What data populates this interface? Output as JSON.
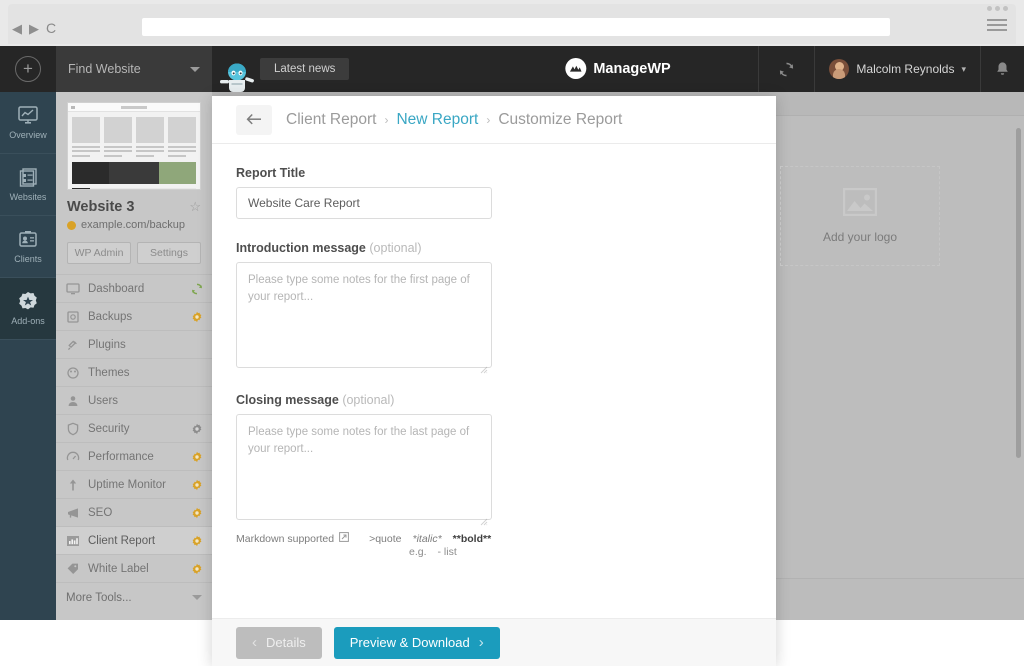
{
  "browser": {
    "back_icon": "back-arrow-icon",
    "forward_icon": "forward-arrow-icon",
    "reload_glyph": "C",
    "address_value": "",
    "address_placeholder": "",
    "menu_icon": "hamburger-menu-icon",
    "dots_icon": "more-options-icon"
  },
  "rail": {
    "add_label": "+",
    "items": [
      {
        "label": "Overview",
        "icon": "overview-monitor-icon"
      },
      {
        "label": "Websites",
        "icon": "websites-list-icon"
      },
      {
        "label": "Clients",
        "icon": "clients-card-icon"
      },
      {
        "label": "Add-ons",
        "icon": "addons-star-badge-icon"
      }
    ]
  },
  "sidebar": {
    "find_website": "Find Website",
    "site_name": "Website 3",
    "site_url": "example.com/backup",
    "favorite_icon": "star-icon",
    "status_dot_color": "#d9a227",
    "wp_admin_label": "WP Admin",
    "settings_label": "Settings",
    "more_tools_label": "More Tools...",
    "menu": [
      {
        "label": "Dashboard",
        "icon": "dashboard-monitor-icon",
        "badge": "sync",
        "active": false
      },
      {
        "label": "Backups",
        "icon": "backups-drive-icon",
        "badge": "gold",
        "active": false
      },
      {
        "label": "Plugins",
        "icon": "plugins-plug-icon",
        "badge": "none",
        "active": false
      },
      {
        "label": "Themes",
        "icon": "themes-brush-icon",
        "badge": "none",
        "active": false
      },
      {
        "label": "Users",
        "icon": "users-person-icon",
        "badge": "none",
        "active": false
      },
      {
        "label": "Security",
        "icon": "security-shield-icon",
        "badge": "gray",
        "active": false
      },
      {
        "label": "Performance",
        "icon": "performance-gauge-icon",
        "badge": "gold",
        "active": false
      },
      {
        "label": "Uptime Monitor",
        "icon": "uptime-arrow-icon",
        "badge": "gold",
        "active": false
      },
      {
        "label": "SEO",
        "icon": "seo-megaphone-icon",
        "badge": "gold",
        "active": false
      },
      {
        "label": "Client Report",
        "icon": "client-report-chart-icon",
        "badge": "gold",
        "active": true
      },
      {
        "label": "White Label",
        "icon": "white-label-tag-icon",
        "badge": "gold",
        "active": false
      }
    ]
  },
  "topbar": {
    "news_label": "Latest news",
    "brand_name": "ManageWP",
    "brand_mark_icon": "managewp-logo-icon",
    "mascot_icon": "mascot-robot-icon",
    "sync_icon": "sync-icon",
    "user_name": "Malcolm Reynolds",
    "user_caret": "▾",
    "avatar_icon": "avatar",
    "bell_icon": "notifications-bell-icon"
  },
  "modal": {
    "back_icon": "back-arrow-icon",
    "breadcrumb": [
      {
        "label": "Client Report",
        "current": false
      },
      {
        "label": "New Report",
        "current": true
      },
      {
        "label": "Customize Report",
        "current": false
      }
    ],
    "breadcrumb_separator": "›",
    "report_title_label": "Report Title",
    "report_title_value": "Website Care Report",
    "report_title_placeholder": "Report title",
    "intro_label": "Introduction message",
    "intro_optional": "(optional)",
    "intro_value": "",
    "intro_placeholder": "Please type some notes for the first page of your report...",
    "closing_label": "Closing message",
    "closing_optional": "(optional)",
    "closing_value": "",
    "closing_placeholder": "Please type some notes for the last page of your report...",
    "logo_drop_label": "Add your logo",
    "logo_drop_icon": "image-placeholder-icon",
    "markdown_label": "Markdown supported",
    "markdown_icon": "external-link-icon",
    "markdown_quote": ">quote",
    "markdown_italic": "*italic*",
    "markdown_bold": "**bold**",
    "markdown_eg": "e.g.",
    "markdown_list": "- list",
    "details_label": "Details",
    "details_chevron": "‹",
    "primary_label": "Preview & Download",
    "primary_chevron": "›",
    "primary_color": "#1b9cbd"
  }
}
